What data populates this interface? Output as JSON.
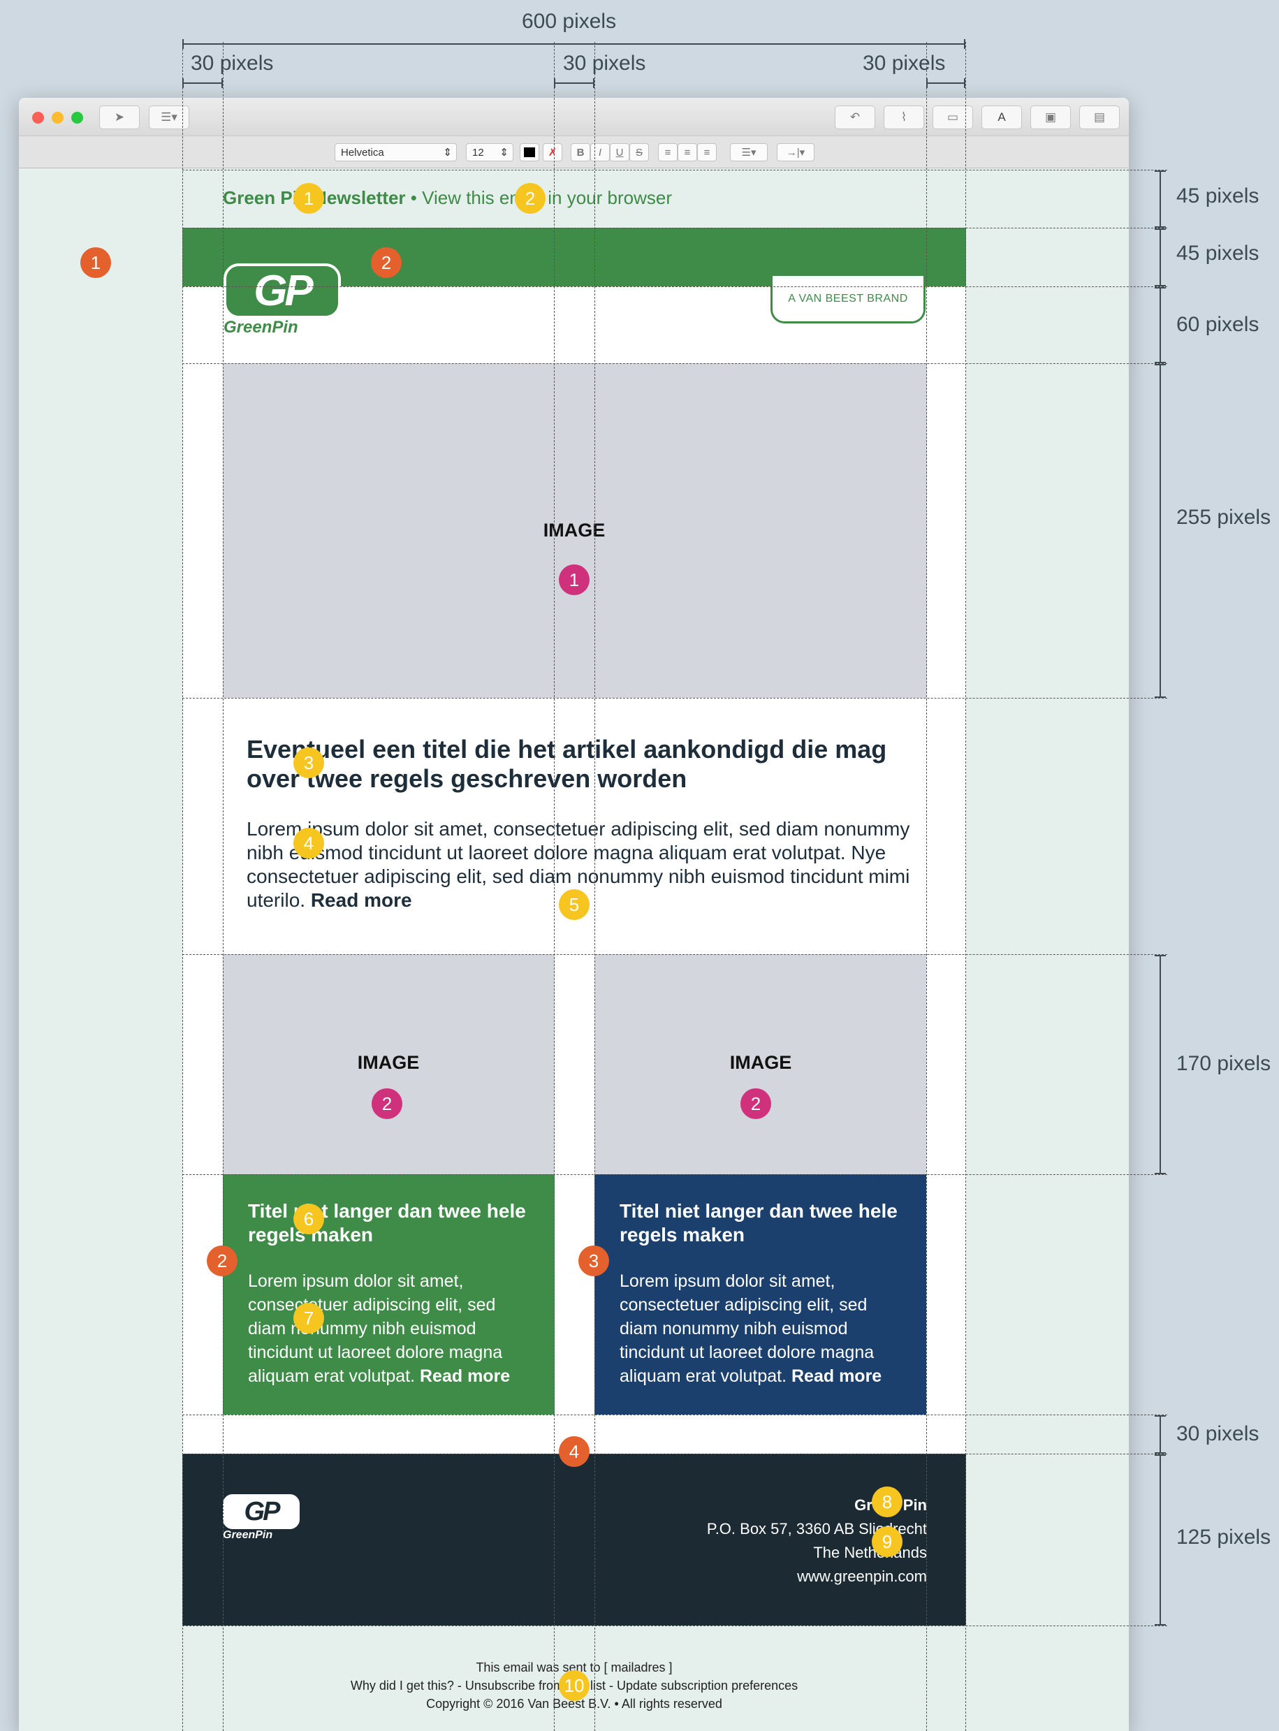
{
  "measurements": {
    "top": "600 pixels",
    "left_gutter": "30 pixels",
    "middle_gutter": "30 pixels",
    "right_gutter": "30 pixels",
    "preheader_h": "45 pixels",
    "band_h": "45 pixels",
    "header_h": "60 pixels",
    "hero_h": "255 pixels",
    "twocol_h": "170 pixels",
    "spacer_h": "30 pixels",
    "footer_h": "125 pixels"
  },
  "toolbar": {
    "font_name": "Helvetica",
    "font_size": "12",
    "bold": "B",
    "italic": "I",
    "underline": "U",
    "strike": "S",
    "font_button": "A"
  },
  "email": {
    "preheader_brand": "Green Pin Newsletter",
    "preheader_link": " • View this email in your browser",
    "logo_mark": "GP",
    "logo_word": "GreenPin",
    "brand_badge": "A VAN BEEST BRAND",
    "hero_label": "IMAGE",
    "article_title": "Eventueel een titel die het artikel aankondigd die mag over twee regels geschreven worden",
    "article_body": "Lorem ipsum dolor sit amet, consectetuer adipiscing elit, sed diam nonummy nibh euismod tincidunt ut laoreet dolore magna aliquam erat volutpat. Nye consectetuer adipiscing elit, sed diam nonummy nibh euismod tincidunt mimi uterilo. ",
    "article_readmore": "Read more",
    "col_left_image": "IMAGE",
    "col_right_image": "IMAGE",
    "col_left_title": "Titel niet langer dan twee hele regels maken",
    "col_left_body": "Lorem ipsum dolor sit amet, consectetuer adipiscing elit, sed diam nonummy nibh euismod tincidunt ut laoreet dolore magna aliquam erat volutpat. ",
    "col_left_readmore": "Read more",
    "col_right_title": "Titel niet langer dan twee hele regels maken",
    "col_right_body": "Lorem ipsum dolor sit amet, consectetuer adipiscing elit, sed diam nonummy nibh euismod tincidunt ut laoreet dolore magna aliquam erat volutpat. ",
    "col_right_readmore": "Read more",
    "footer_logo_mark": "GP",
    "footer_logo_word": "GreenPin",
    "footer_company": "Green Pin",
    "footer_address": "P.O. Box 57, 3360 AB Sliedrecht",
    "footer_country": "The Netherlands",
    "footer_website": "www.greenpin.com",
    "sub_line1": "This email was sent to [ mailadres ]",
    "sub_line2": "Why did I get this? - Unsubscribe from this list - Update subscription preferences",
    "sub_line3": "Copyright © 2016 Van Beest B.V. • All rights reserved"
  },
  "markers": {
    "y1": "1",
    "y2": "2",
    "y3": "3",
    "y4": "4",
    "y5": "5",
    "y6": "6",
    "y7": "7",
    "y8": "8",
    "y9": "9",
    "y10": "10",
    "o1": "1",
    "o2": "2",
    "o2b": "2",
    "o3": "3",
    "o4": "4",
    "p1": "1",
    "p2a": "2",
    "p2b": "2"
  },
  "colors": {
    "green": "#3f8b48",
    "navy": "#1b406d",
    "footer": "#1c2a33",
    "image_placeholder": "#d3d6dc",
    "canvas": "#e5efec"
  }
}
